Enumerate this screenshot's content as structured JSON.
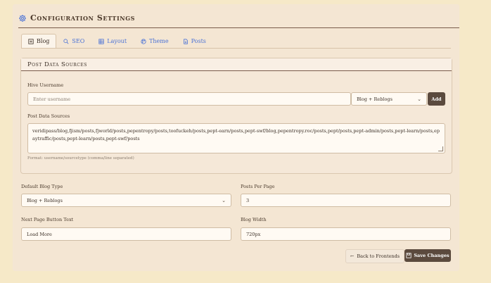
{
  "header": {
    "title": "Configuration Settings",
    "icon": "gear-icon"
  },
  "tabs": [
    {
      "label": "Blog",
      "icon": "blog-icon",
      "active": true
    },
    {
      "label": "SEO",
      "icon": "search-icon",
      "active": false
    },
    {
      "label": "Layout",
      "icon": "grid-icon",
      "active": false
    },
    {
      "label": "Theme",
      "icon": "palette-icon",
      "active": false
    },
    {
      "label": "Posts",
      "icon": "document-icon",
      "active": false
    }
  ],
  "post_sources": {
    "title": "Post Data Sources",
    "hive_label": "Hive Username",
    "hive_placeholder": "Enter username",
    "type_select": "Blog + Reblogs",
    "add_label": "Add",
    "sources_label": "Post Data Sources",
    "sources_value": "veridipass/blog,fjism/posts,fjworld/posts,pepentropy/posts,toofuckeh/posts,pept-earn/posts,pept-swf/blog,pepentropy.roc/posts,pept/posts,pept-admin/posts,pept-learn/posts,epaytraffic/posts,pept-learn/posts,pept-swf/posts",
    "format_hint": "Format: username/sourcetype (comma/line separated)"
  },
  "settings": {
    "default_blog_type_label": "Default Blog Type",
    "default_blog_type_value": "Blog + Reblogs",
    "posts_per_page_label": "Posts Per Page",
    "posts_per_page_value": "3",
    "next_page_label": "Next Page Button Text",
    "next_page_value": "Load More",
    "blog_width_label": "Blog Width",
    "blog_width_value": "720px"
  },
  "actions": {
    "back_label": "Back to Frontends",
    "save_label": "Save Changes"
  },
  "colors": {
    "accent": "#4a72d6",
    "button_dark": "#5b4a3e",
    "page_bg": "#f6e9c8",
    "panel_bg": "#f4e6d3"
  }
}
